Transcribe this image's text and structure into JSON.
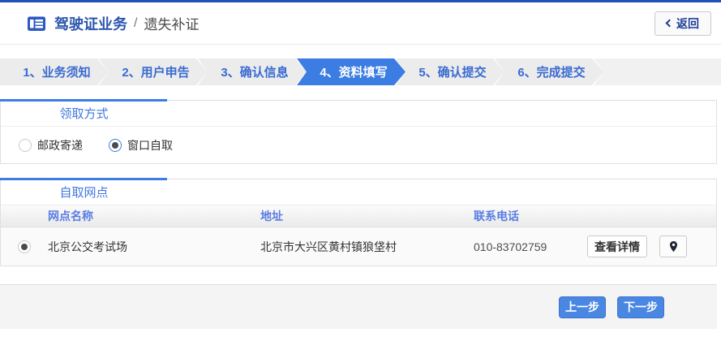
{
  "colors": {
    "top_bar": "#2150b8",
    "accent_blue": "#3b7de2",
    "title_blue": "#2b55ad",
    "step_text_blue": "#3a6bd0",
    "section_label_blue": "#4077e0",
    "table_header_blue": "#5a7ce4",
    "button_blue": "#4a87e2"
  },
  "header": {
    "icon": "license-card-icon",
    "title": "驾驶证业务",
    "separator": "/",
    "subtitle": "遗失补证",
    "back_icon": "chevron-left-icon",
    "back_label": "返回"
  },
  "steps": [
    {
      "label": "1、业务须知",
      "active": false
    },
    {
      "label": "2、用户申告",
      "active": false
    },
    {
      "label": "3、确认信息",
      "active": false
    },
    {
      "label": "4、资料填写",
      "active": true
    },
    {
      "label": "5、确认提交",
      "active": false
    },
    {
      "label": "6、完成提交",
      "active": false
    }
  ],
  "pickup_section": {
    "title": "领取方式",
    "options": [
      {
        "label": "邮政寄递",
        "selected": false
      },
      {
        "label": "窗口自取",
        "selected": true
      }
    ]
  },
  "outlets_section": {
    "title": "自取网点",
    "table": {
      "headers": {
        "name": "网点名称",
        "address": "地址",
        "phone": "联系电话"
      },
      "rows": [
        {
          "selected": true,
          "name": "北京公交考试场",
          "address": "北京市大兴区黄村镇狼垡村",
          "phone": "010-83702759",
          "detail_button": "查看详情",
          "pin_icon": "map-pin-icon"
        }
      ]
    }
  },
  "footer": {
    "prev_label": "上一步",
    "next_label": "下一步"
  }
}
